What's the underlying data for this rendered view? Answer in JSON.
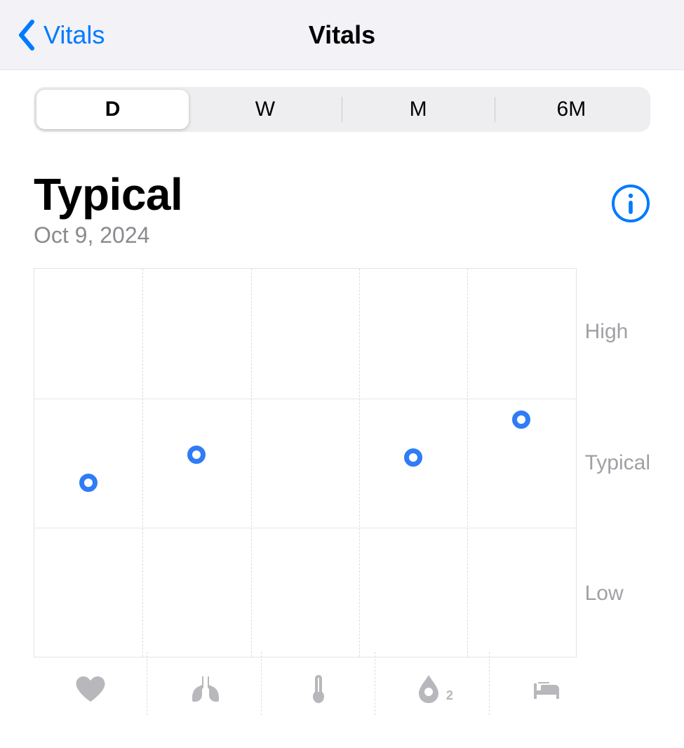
{
  "nav": {
    "back_label": "Vitals",
    "title": "Vitals"
  },
  "segments": {
    "items": [
      "D",
      "W",
      "M",
      "6M"
    ],
    "selected_index": 0
  },
  "heading": {
    "status": "Typical",
    "date": "Oct 9, 2024"
  },
  "colors": {
    "accent": "#007aff",
    "point": "#2f7cf6",
    "muted": "#a0a0a6"
  },
  "chart_data": {
    "type": "scatter",
    "title": "",
    "xlabel": "",
    "ylabel": "",
    "y_categories": [
      "Low",
      "Typical",
      "High"
    ],
    "x_categories": [
      "heart-rate",
      "respiratory-rate",
      "wrist-temperature",
      "blood-oxygen",
      "sleep-duration"
    ],
    "x_icon_names": [
      "heart-icon",
      "lungs-icon",
      "thermometer-icon",
      "blood-oxygen-icon",
      "bed-icon"
    ],
    "ylim": [
      0,
      3
    ],
    "series": [
      {
        "name": "vitals",
        "points": [
          {
            "x": "heart-rate",
            "y": "Typical",
            "y_offset": -0.08
          },
          {
            "x": "respiratory-rate",
            "y": "Typical",
            "y_offset": 0.1
          },
          {
            "x": "blood-oxygen",
            "y": "Typical",
            "y_offset": 0.12
          },
          {
            "x": "sleep-duration",
            "y": "Typical",
            "y_offset": 0.38
          }
        ]
      }
    ],
    "y_axis_labels": {
      "top": "High",
      "mid": "Typical",
      "bottom": "Low"
    }
  }
}
